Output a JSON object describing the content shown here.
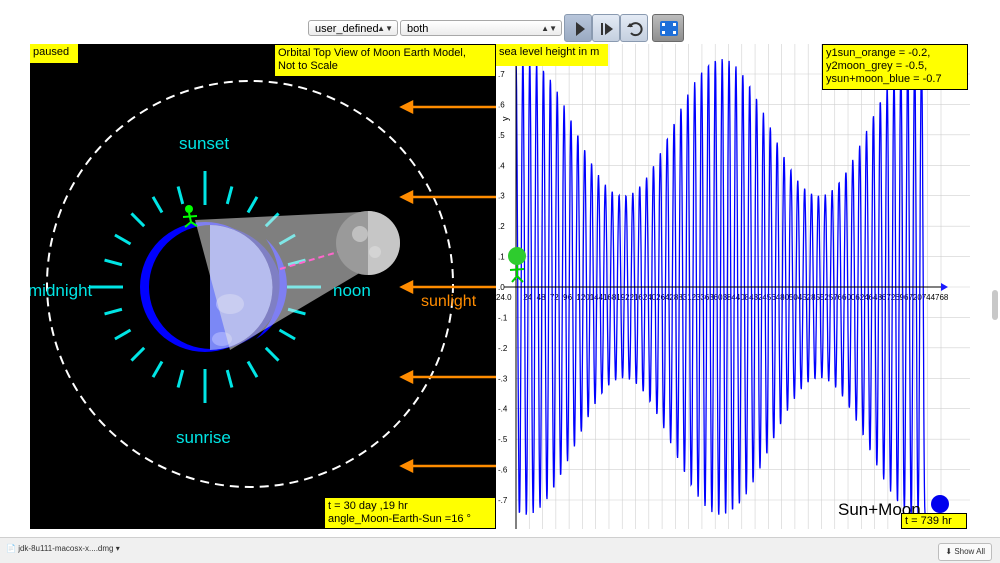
{
  "toolbar": {
    "select1": {
      "value": "user_defined"
    },
    "select2": {
      "value": "both"
    },
    "buttons": [
      "play-icon",
      "step-forward-icon",
      "reset-icon",
      "fullscreen-icon"
    ]
  },
  "left_panel": {
    "status": "paused",
    "title_line1": "Orbital Top View of Moon Earth Model,",
    "title_line2": "Not to Scale",
    "labels": {
      "sunset": "sunset",
      "midnight": "midnight",
      "noon": "noon",
      "sunrise": "sunrise",
      "sunlight": "sunlight"
    },
    "readout_line1": "t = 30 day ,19 hr",
    "readout_line2": "angle_Moon-Earth-Sun =16 °",
    "colors": {
      "label": "#00e5e5",
      "sunlight": "#ff8c00",
      "earth_dark": "#0000ff",
      "box": "#ffff00"
    }
  },
  "plot": {
    "title": "sea level height in m",
    "y_axis_label": "y",
    "legend_line1": "y1sun_orange = -0.2,",
    "legend_line2": "y2moon_grey = -0.5,",
    "legend_line3": "ysun+moon_blue = -0.7",
    "series_label": "Sun+Moon",
    "time_readout": "t = 739 hr",
    "y_ticks": [
      "0.7",
      "0.6",
      "0.5",
      "0.4",
      "0.3",
      "0.2",
      "0.1",
      "0.0",
      "-0.1",
      "-0.2",
      "-0.3",
      "-0.4",
      "-0.5",
      "-0.6",
      "-0.7"
    ],
    "x_ticks": [
      "24.0",
      "24",
      "48",
      "72",
      "96",
      "120",
      "144",
      "168",
      "192",
      "216",
      "240",
      "264",
      "288",
      "312",
      "336",
      "360",
      "384",
      "408",
      "432",
      "456",
      "480",
      "504",
      "528",
      "552",
      "576",
      "600",
      "624",
      "648",
      "672",
      "696",
      "720",
      "744",
      "768"
    ],
    "colors": {
      "wave": "#0000ff",
      "grid": "#d0d0d0"
    }
  },
  "chart_data": {
    "type": "line",
    "title": "sea level height in m",
    "ylabel": "y",
    "xlabel": "",
    "ylim": [
      -0.75,
      0.75
    ],
    "xlim": [
      0,
      768
    ],
    "series": [
      {
        "name": "Sun+Moon",
        "semidiurnal_period_hr": 12.42,
        "spring_amplitude": 0.75,
        "neap_amplitude": 0.3,
        "spring_neap_period_hr": 354
      }
    ]
  },
  "bottom_bar": {
    "download_name": "jdk-8u111-macosx-x....dmg",
    "show_all": "Show All"
  }
}
